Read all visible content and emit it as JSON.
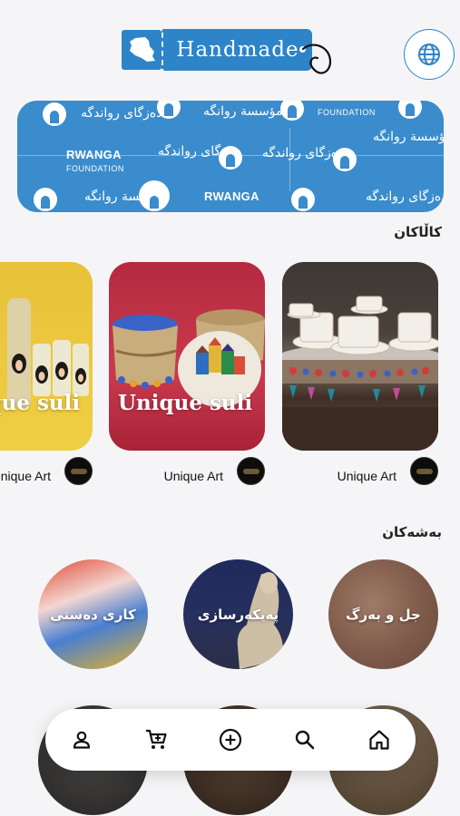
{
  "header": {
    "logo_text": "Handmade",
    "language_button": "globe-icon"
  },
  "banner": {
    "org_name": "RWANGA",
    "org_sub": "FOUNDATION",
    "kurdish_name": "دەزگای رواندگە",
    "arabic_name": "مؤسسة روانگە"
  },
  "products_section": {
    "title": "کاڵاکان",
    "items": [
      {
        "name": "Unique Art"
      },
      {
        "name": "Unique Art",
        "watermark": "Unique suli"
      },
      {
        "name": "Unique Art",
        "watermark": "Unique suli"
      }
    ]
  },
  "categories_section": {
    "title": "بەشەکان",
    "items": [
      {
        "label": "جل و بەرگ"
      },
      {
        "label": "پەیکەرسازی"
      },
      {
        "label": "کاری دەستی"
      }
    ]
  },
  "bottom_nav": {
    "items": [
      "home-icon",
      "search-icon",
      "add-icon",
      "cart-icon",
      "profile-icon"
    ]
  },
  "colors": {
    "brand": "#2d84c8",
    "banner": "#3a8ccd",
    "background": "#f5f5f7"
  }
}
